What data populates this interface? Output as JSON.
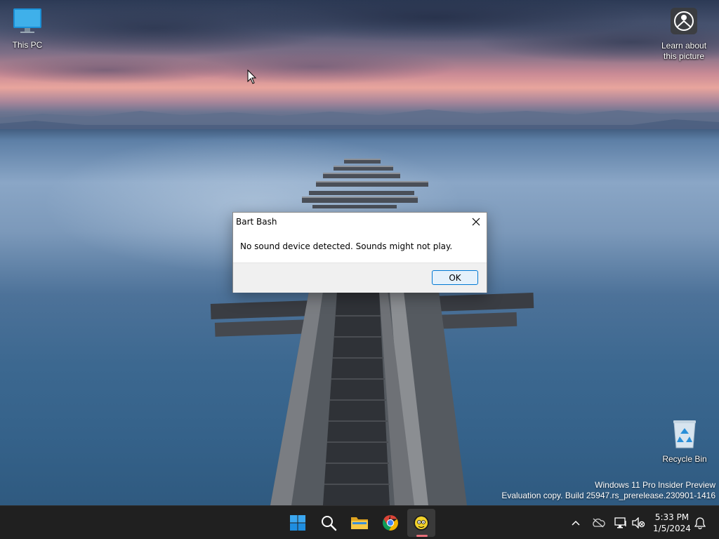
{
  "desktop": {
    "icons": {
      "this_pc": "This PC",
      "learn_line1": "Learn about",
      "learn_line2": "this picture",
      "recycle_bin": "Recycle Bin"
    },
    "watermark": {
      "line1": "Windows 11 Pro Insider Preview",
      "line2": "Evaluation copy. Build 25947.rs_prerelease.230901-1416"
    }
  },
  "dialog": {
    "title": "Bart Bash",
    "message": "No sound device detected. Sounds might not play.",
    "ok_label": "OK"
  },
  "taskbar": {
    "apps": [
      "start-icon",
      "search-icon",
      "file-explorer-icon",
      "chrome-icon",
      "bart-bash-app-icon"
    ],
    "active_app": "Bart Bash",
    "accent_color": "#e8707a"
  },
  "tray": {
    "time": "5:33 PM",
    "date": "1/5/2024"
  }
}
